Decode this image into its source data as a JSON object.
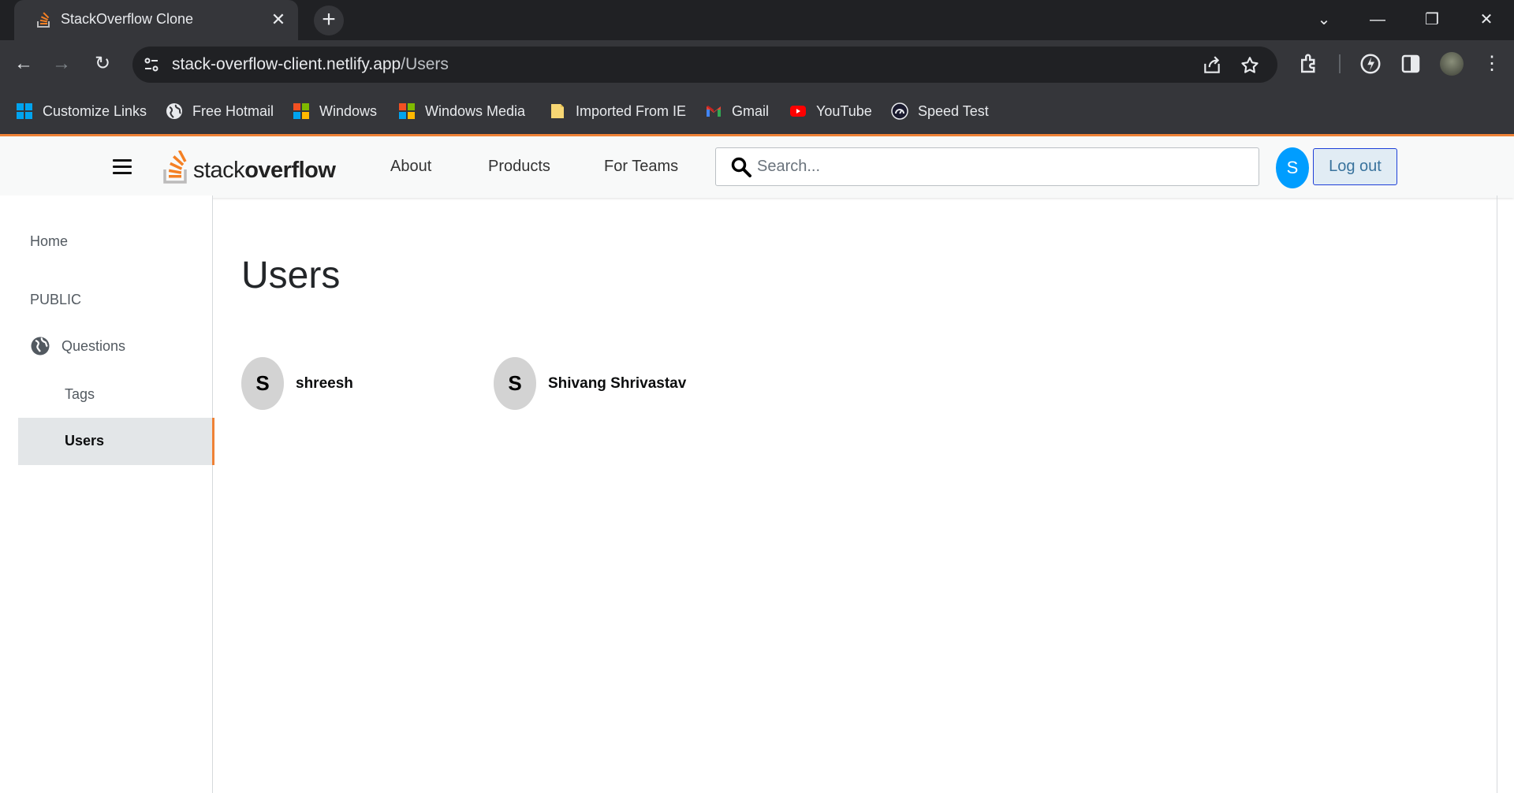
{
  "browser": {
    "tab_title": "StackOverflow Clone",
    "address": {
      "host": "stack-overflow-client.netlify.app",
      "path": "/Users"
    },
    "bookmarks": [
      {
        "label": "Customize Links",
        "icon": "windows-icon"
      },
      {
        "label": "Free Hotmail",
        "icon": "globe-icon"
      },
      {
        "label": "Windows",
        "icon": "windows-icon"
      },
      {
        "label": "Windows Media",
        "icon": "windows-icon"
      },
      {
        "label": "Imported From IE",
        "icon": "folder-icon"
      },
      {
        "label": "Gmail",
        "icon": "gmail-icon"
      },
      {
        "label": "YouTube",
        "icon": "youtube-icon"
      },
      {
        "label": "Speed Test",
        "icon": "speedometer-icon"
      }
    ]
  },
  "navbar": {
    "logo": {
      "light": "stack",
      "bold": "overflow"
    },
    "links": [
      "About",
      "Products",
      "For Teams"
    ],
    "search_placeholder": "Search...",
    "avatar_letter": "S",
    "logout_label": "Log out"
  },
  "sidebar": {
    "home": "Home",
    "public": "PUBLIC",
    "questions": "Questions",
    "tags": "Tags",
    "users": "Users"
  },
  "main": {
    "title": "Users",
    "users": [
      {
        "initial": "S",
        "name": "shreesh"
      },
      {
        "initial": "S",
        "name": "Shivang Shrivastav"
      }
    ]
  },
  "colors": {
    "accent": "#ef8236",
    "avatar_blue": "#009dff",
    "logout_bg": "#e1ecf4"
  }
}
